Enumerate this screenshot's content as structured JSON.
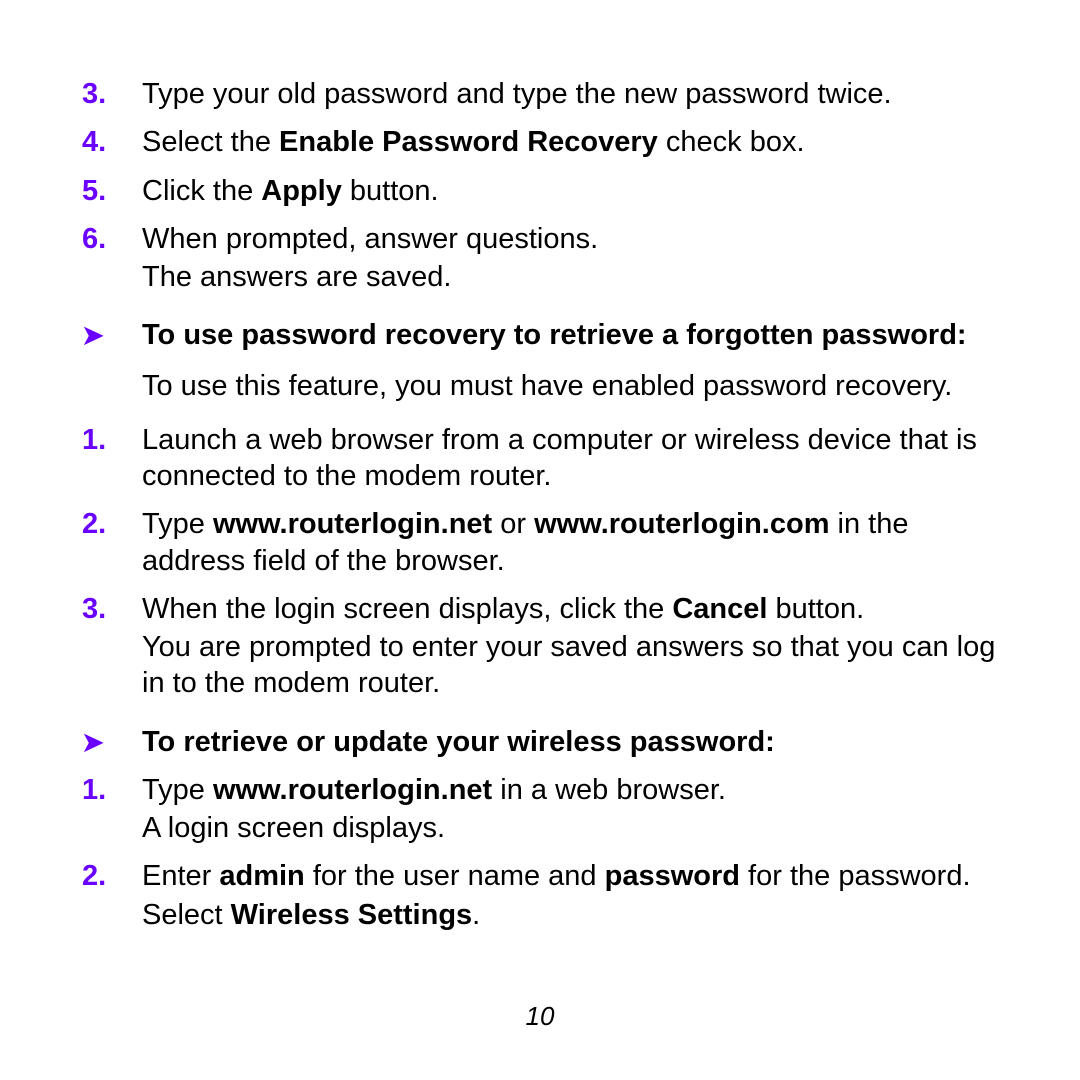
{
  "colors": {
    "accent": "#6a00ff"
  },
  "top_steps": {
    "s3": {
      "num": "3.",
      "text": "Type your old password and type the new password twice."
    },
    "s4": {
      "num": "4.",
      "pre": "Select the ",
      "bold": "Enable Password Recovery",
      "post": " check box."
    },
    "s5": {
      "num": "5.",
      "pre": "Click the ",
      "bold": "Apply",
      "post": " button."
    },
    "s6": {
      "num": "6.",
      "line1": "When prompted, answer questions.",
      "line2": "The answers are saved."
    }
  },
  "section_recovery": {
    "arrow": "➤",
    "heading": "To use password recovery to retrieve a forgotten password:",
    "intro": "To use this feature, you must have enabled password recovery.",
    "s1": {
      "num": "1.",
      "text": "Launch a web browser from a computer or wireless device that is connected to the modem router."
    },
    "s2": {
      "num": "2.",
      "pre": "Type ",
      "b1": "www.routerlogin.net",
      "mid": " or ",
      "b2": "www.routerlogin.com",
      "post": " in the address field of the browser."
    },
    "s3": {
      "num": "3.",
      "l1pre": "When the login screen displays, click the ",
      "l1b": "Cancel",
      "l1post": " button.",
      "l2": "You are prompted to enter your saved answers so that you can log in to the modem router."
    }
  },
  "section_wireless": {
    "arrow": "➤",
    "heading": "To retrieve or update your wireless password:",
    "s1": {
      "num": "1.",
      "l1pre": "Type ",
      "l1b": "www.routerlogin.net",
      "l1post": " in a web browser.",
      "l2": "A login screen displays."
    },
    "s2": {
      "num": "2.",
      "l1a": "Enter ",
      "l1b1": "admin",
      "l1c": " for the user name and ",
      "l1b2": "password",
      "l1d": " for the password.",
      "l2pre": "Select ",
      "l2b": "Wireless Settings",
      "l2post": "."
    }
  },
  "page_number": "10"
}
